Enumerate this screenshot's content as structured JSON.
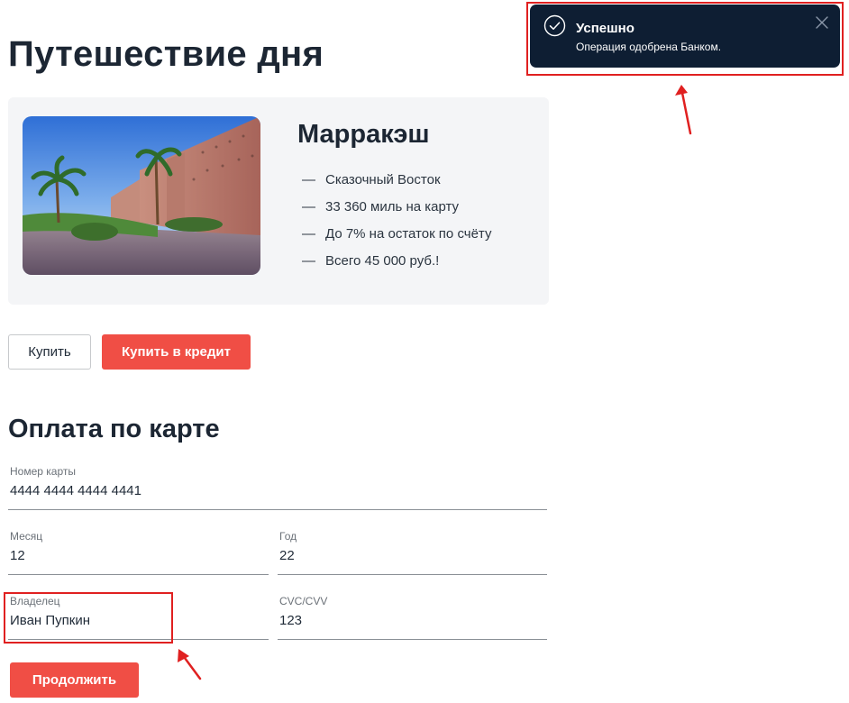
{
  "page": {
    "title": "Путешествие дня"
  },
  "tour": {
    "city": "Марракэш",
    "dash": "—",
    "features": [
      "Сказочный Восток",
      "33 360 миль на карту",
      "До 7% на остаток по счёту",
      "Всего 45 000 руб.!"
    ]
  },
  "actions": {
    "buy_label": "Купить",
    "buy_credit_label": "Купить в кредит"
  },
  "payment": {
    "title": "Оплата по карте",
    "card_number": {
      "label": "Номер карты",
      "value": "4444 4444 4444 4441"
    },
    "month": {
      "label": "Месяц",
      "value": "12"
    },
    "year": {
      "label": "Год",
      "value": "22"
    },
    "owner": {
      "label": "Владелец",
      "value": "Иван Пупкин"
    },
    "cvc": {
      "label": "CVC/CVV",
      "value": "123"
    },
    "continue_label": "Продолжить"
  },
  "notification": {
    "title": "Успешно",
    "message": "Операция одобрена Банком.",
    "status_icon": "check-circle-icon",
    "close_icon": "close-icon"
  },
  "colors": {
    "accent_red": "#f04e45",
    "toast_bg": "#0e1e33",
    "card_bg": "#f4f5f7",
    "annotation_red": "#e02020"
  }
}
